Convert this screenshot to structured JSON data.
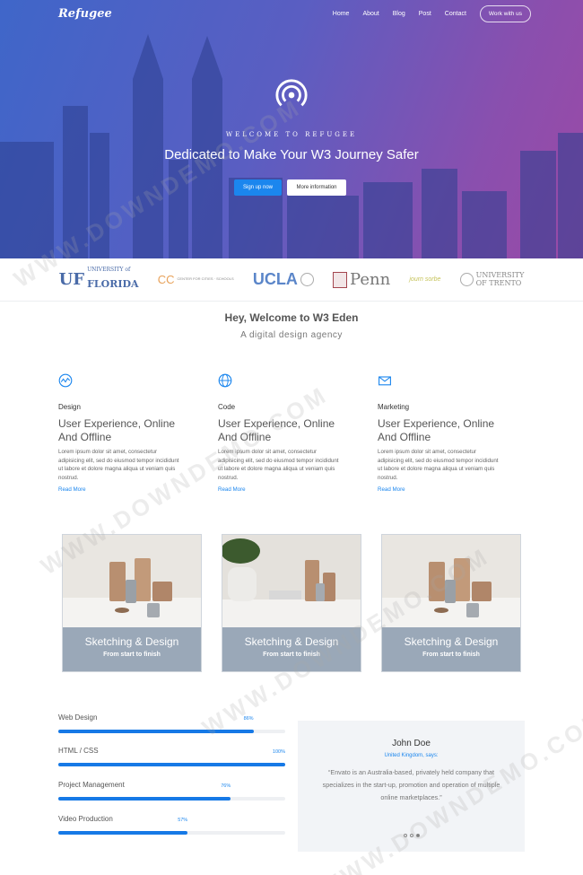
{
  "brand": "Refugee",
  "nav": {
    "items": [
      "Home",
      "About",
      "Blog",
      "Post",
      "Contact"
    ],
    "cta": "Work with us"
  },
  "hero": {
    "eyebrow": "WELCOME TO REFUGEE",
    "title": "Dedicated to Make Your W3 Journey Safer",
    "primary_button": "Sign up now",
    "secondary_button": "More information",
    "icon": "broadcast-signal-icon"
  },
  "logos": {
    "uf": {
      "small": "UNIVERSITY of",
      "mark": "UF",
      "name": "FLORIDA"
    },
    "cc": {
      "mark": "CC",
      "small": "CENTER FOR CITIES · SCHOOLS"
    },
    "ucla": "UCLA",
    "penn": "Penn",
    "js": "journ sorbe",
    "trento": [
      "UNIVERSITY",
      "OF TRENTO"
    ]
  },
  "intro": {
    "title": "Hey, Welcome to W3 Eden",
    "subtitle": "A digital design agency"
  },
  "features": [
    {
      "icon": "chart-line-icon",
      "label": "Design",
      "title": "User Experience, Online And Offline",
      "desc": "Lorem ipsum dolor sit amet, consectetur adipisicing elit, sed do eiusmod tempor incididunt ut labore et dolore magna aliqua ut veniam quis nostrud.",
      "link": "Read More"
    },
    {
      "icon": "globe-icon",
      "label": "Code",
      "title": "User Experience, Online And Offline",
      "desc": "Lorem ipsum dolor sit amet, consectetur adipisicing elit, sed do eiusmod tempor incididunt ut labore et dolore magna aliqua ut veniam quis nostrud.",
      "link": "Read More"
    },
    {
      "icon": "envelope-icon",
      "label": "Marketing",
      "title": "User Experience, Online And Offline",
      "desc": "Lorem ipsum dolor sit amet, consectetur adipisicing elit, sed do eiusmod tempor incididunt ut labore et dolore magna aliqua ut veniam quis nostrud.",
      "link": "Read More"
    }
  ],
  "cards": [
    {
      "title": "Sketching & Design",
      "subtitle": "From start to finish"
    },
    {
      "title": "Sketching & Design",
      "subtitle": "From start to finish"
    },
    {
      "title": "Sketching & Design",
      "subtitle": "From start to finish"
    }
  ],
  "skills": [
    {
      "label": "Web Design",
      "percent": 86,
      "percent_text": "86%"
    },
    {
      "label": "HTML / CSS",
      "percent": 100,
      "percent_text": "100%"
    },
    {
      "label": "Project Management",
      "percent": 76,
      "percent_text": "76%"
    },
    {
      "label": "Video Production",
      "percent": 57,
      "percent_text": "57%"
    }
  ],
  "testimonial": {
    "name": "John Doe",
    "location": "United Kingdom, says:",
    "quote": "“Envato is an Australia-based, privately held company that specializes in the start-up, promotion and operation of multiple online marketplaces.”",
    "active_slide": 3,
    "slides": 3
  },
  "colors": {
    "accent": "#1b86ee",
    "hero_start": "#3f66c9",
    "hero_end": "#9b4aa6",
    "card_caption": "#9aa8b8"
  },
  "watermark": "WWW.DOWNDEMO.COM"
}
